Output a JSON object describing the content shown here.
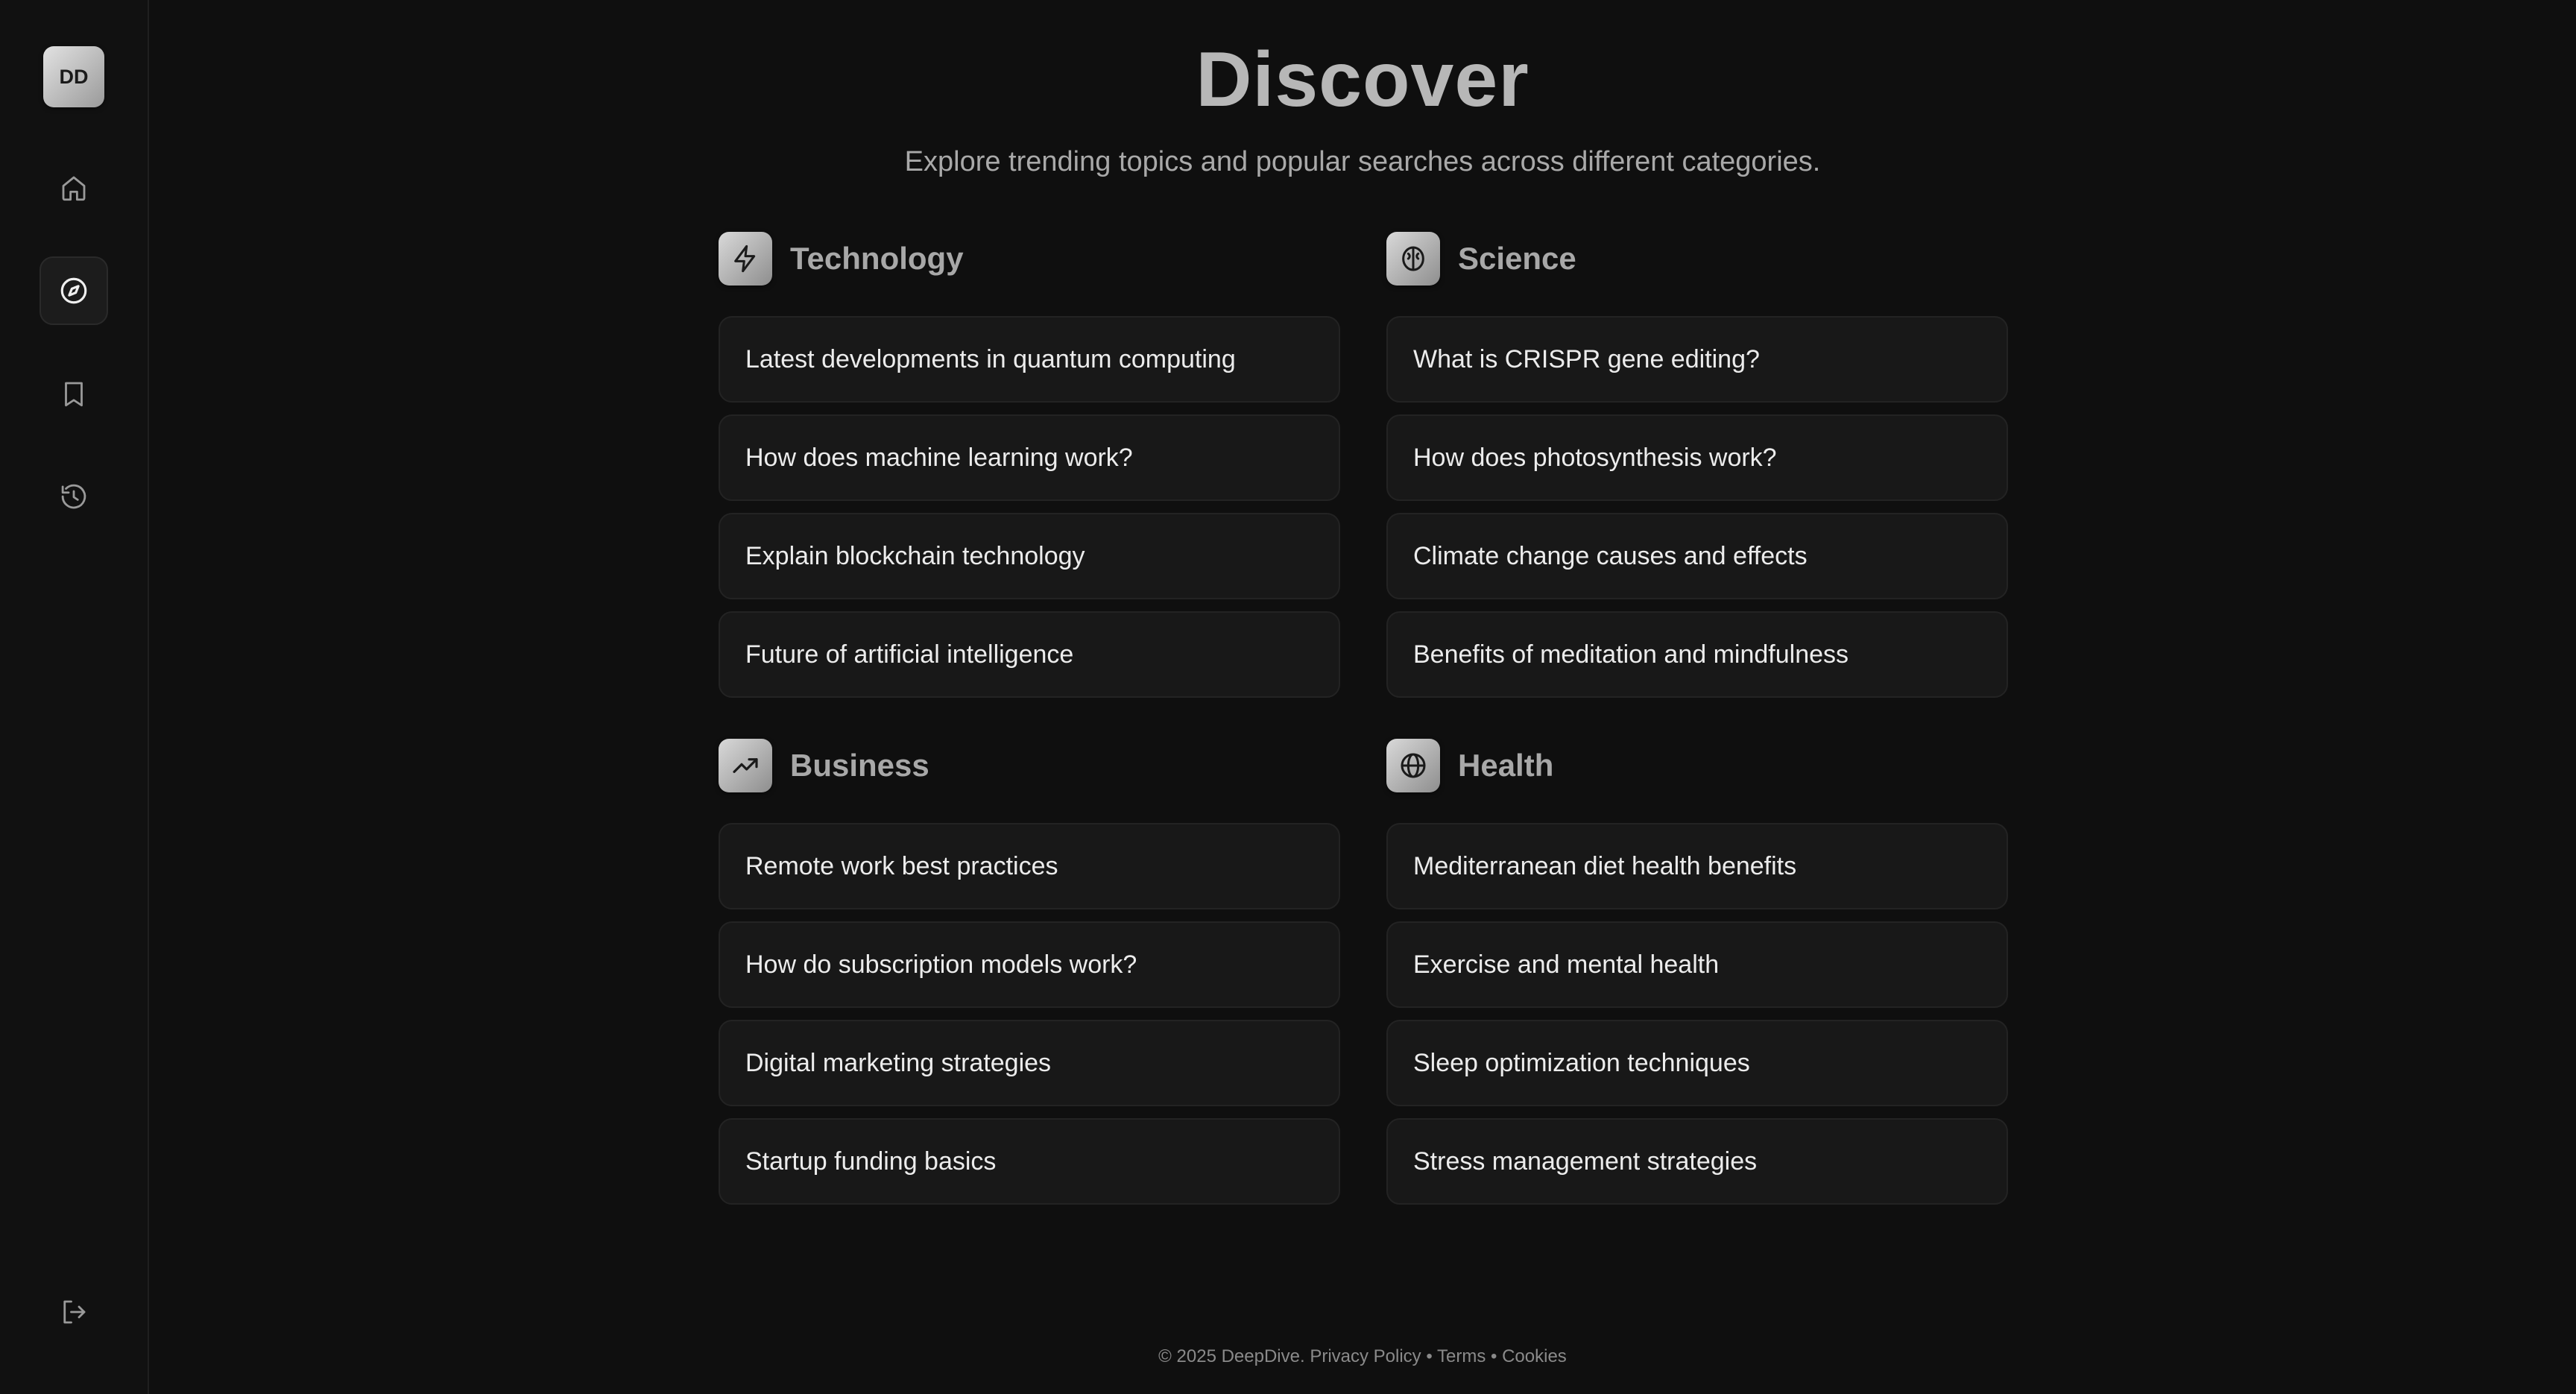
{
  "sidebar": {
    "avatar_initials": "DD",
    "items": [
      {
        "icon": "home-icon"
      },
      {
        "icon": "compass-icon",
        "active": true
      },
      {
        "icon": "bookmark-icon"
      },
      {
        "icon": "history-icon"
      }
    ],
    "logout_icon": "logout-icon"
  },
  "header": {
    "title": "Discover",
    "subtitle": "Explore trending topics and popular searches across different categories."
  },
  "categories": [
    {
      "title": "Technology",
      "icon": "zap-icon",
      "items": [
        "Latest developments in quantum computing",
        "How does machine learning work?",
        "Explain blockchain technology",
        "Future of artificial intelligence"
      ]
    },
    {
      "title": "Science",
      "icon": "brain-icon",
      "items": [
        "What is CRISPR gene editing?",
        "How does photosynthesis work?",
        "Climate change causes and effects",
        "Benefits of meditation and mindfulness"
      ]
    },
    {
      "title": "Business",
      "icon": "trending-up-icon",
      "items": [
        "Remote work best practices",
        "How do subscription models work?",
        "Digital marketing strategies",
        "Startup funding basics"
      ]
    },
    {
      "title": "Health",
      "icon": "globe-icon",
      "items": [
        "Mediterranean diet health benefits",
        "Exercise and mental health",
        "Sleep optimization techniques",
        "Stress management strategies"
      ]
    }
  ],
  "footer": {
    "copyright": "© 2025 DeepDive.",
    "privacy": "Privacy Policy",
    "sep1": "•",
    "terms": "Terms",
    "sep2": "•",
    "cookies": "Cookies"
  }
}
